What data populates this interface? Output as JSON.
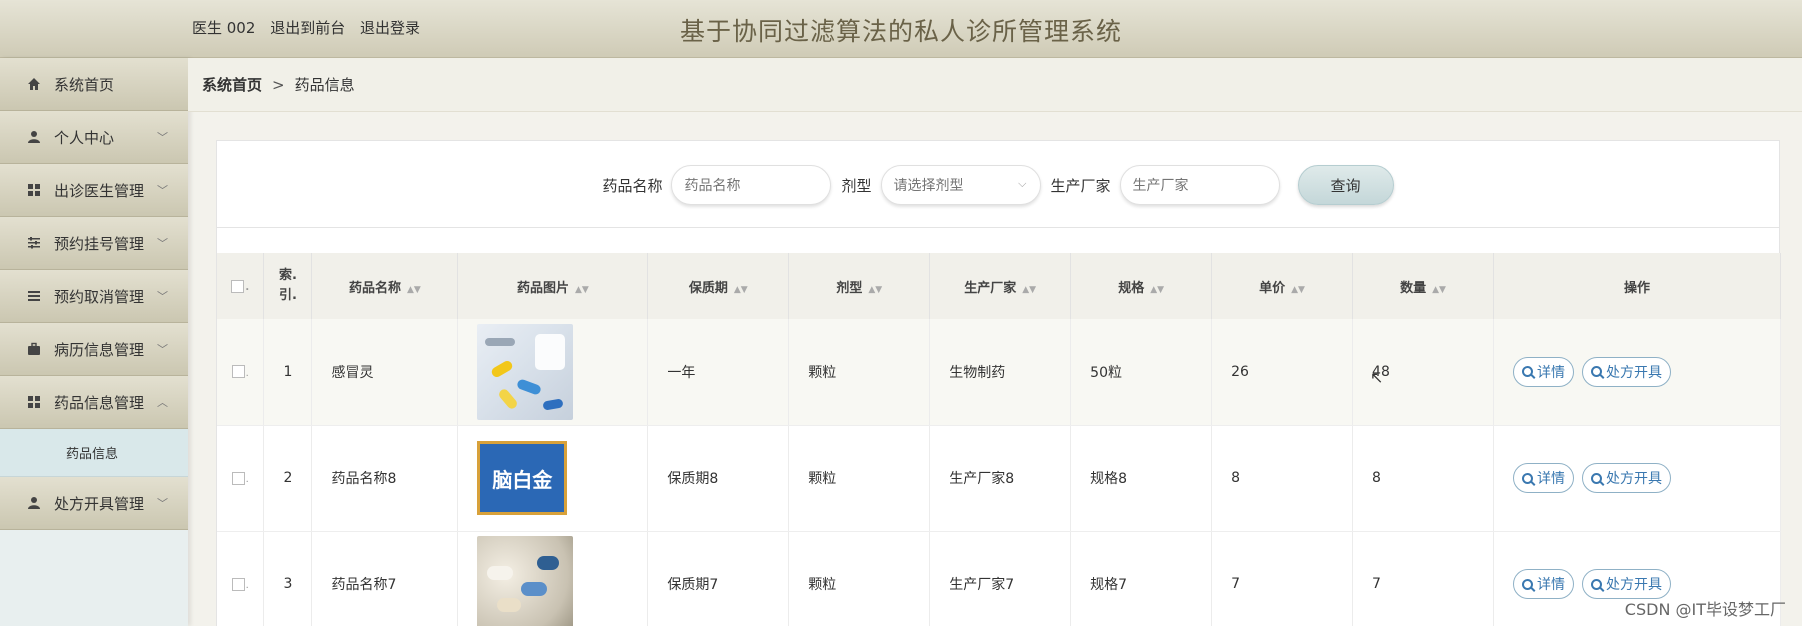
{
  "header": {
    "user": "医生 002",
    "to_front": "退出到前台",
    "logout": "退出登录",
    "title": "基于协同过滤算法的私人诊所管理系统"
  },
  "sidebar": {
    "items": [
      {
        "label": "系统首页",
        "icon": "home-icon",
        "chevron": ""
      },
      {
        "label": "个人中心",
        "icon": "user-icon",
        "chevron": "﹀"
      },
      {
        "label": "出诊医生管理",
        "icon": "grid-icon",
        "chevron": "﹀"
      },
      {
        "label": "预约挂号管理",
        "icon": "sliders-icon",
        "chevron": "﹀"
      },
      {
        "label": "预约取消管理",
        "icon": "list-icon",
        "chevron": "﹀"
      },
      {
        "label": "病历信息管理",
        "icon": "briefcase-icon",
        "chevron": "﹀"
      },
      {
        "label": "药品信息管理",
        "icon": "grid-icon",
        "chevron": "︿"
      },
      {
        "label": "处方开具管理",
        "icon": "user-icon",
        "chevron": "﹀"
      }
    ],
    "sub_item": "药品信息"
  },
  "breadcrumb": {
    "root": "系统首页",
    "sep": ">",
    "current": "药品信息"
  },
  "search": {
    "name_label": "药品名称",
    "name_placeholder": "药品名称",
    "type_label": "剂型",
    "type_placeholder": "请选择剂型",
    "maker_label": "生产厂家",
    "maker_placeholder": "生产厂家",
    "query_button": "查询"
  },
  "table": {
    "headers": {
      "index": "索.\n引.",
      "name": "药品名称",
      "image": "药品图片",
      "shelf": "保质期",
      "form": "剂型",
      "maker": "生产厂家",
      "spec": "规格",
      "price": "单价",
      "qty": "数量",
      "ops": "操作"
    },
    "rows": [
      {
        "index": "1",
        "name": "感冒灵",
        "shelf": "一年",
        "form": "颗粒",
        "maker": "生物制药",
        "spec": "50粒",
        "price": "26",
        "qty": "48"
      },
      {
        "index": "2",
        "name": "药品名称8",
        "shelf": "保质期8",
        "form": "颗粒",
        "maker": "生产厂家8",
        "spec": "规格8",
        "price": "8",
        "qty": "8"
      },
      {
        "index": "3",
        "name": "药品名称7",
        "shelf": "保质期7",
        "form": "颗粒",
        "maker": "生产厂家7",
        "spec": "规格7",
        "price": "7",
        "qty": "7"
      }
    ],
    "detail_button": "详情",
    "prescribe_button": "处方开具",
    "image2_text": "脑白金"
  },
  "watermark": "CSDN @IT毕设梦工厂"
}
